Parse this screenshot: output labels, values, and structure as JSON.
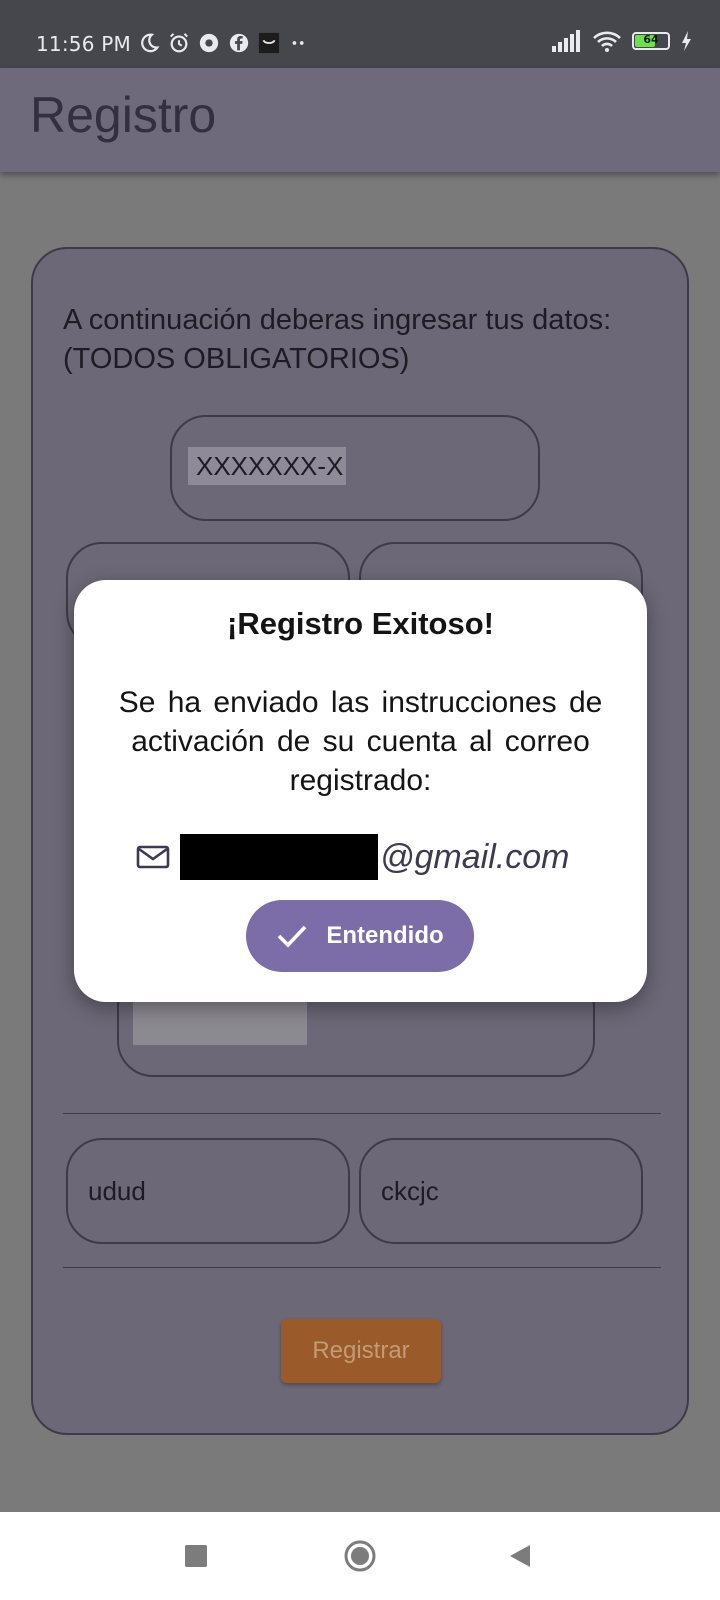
{
  "status_bar": {
    "time": "11:56 PM",
    "battery": "64",
    "battery_level": 0.64,
    "colors": {
      "battery_fill": "#6ee04b"
    },
    "left_icons": [
      "moon-icon",
      "alarm-icon",
      "app-notification-icon",
      "facebook-icon",
      "shop-icon",
      "more-notifications-icon"
    ],
    "right_icons": [
      "signal-icon",
      "wifi-icon",
      "battery-icon",
      "charging-icon"
    ]
  },
  "app_bar": {
    "title": "Registro"
  },
  "form": {
    "instructions": "A continuación deberas ingresar tus datos: (TODOS OBLIGATORIOS)",
    "rut_value": "XXXXXXX-X",
    "field_left_value": "udud",
    "field_right_value": "ckcjc",
    "register_label": "Registrar"
  },
  "dialog": {
    "title": "¡Registro Exitoso!",
    "message": "Se ha enviado las instrucciones de activación de su cuenta al correo registrado:",
    "email_domain": "@gmail.com",
    "confirm_label": "Entendido",
    "colors": {
      "button": "#7c6ca8",
      "email_text": "#3d3951"
    }
  },
  "colors": {
    "app_bar": "#6e6a7c",
    "register_button": "#9a5a2a",
    "scrim_background": "#7a7a7a"
  }
}
